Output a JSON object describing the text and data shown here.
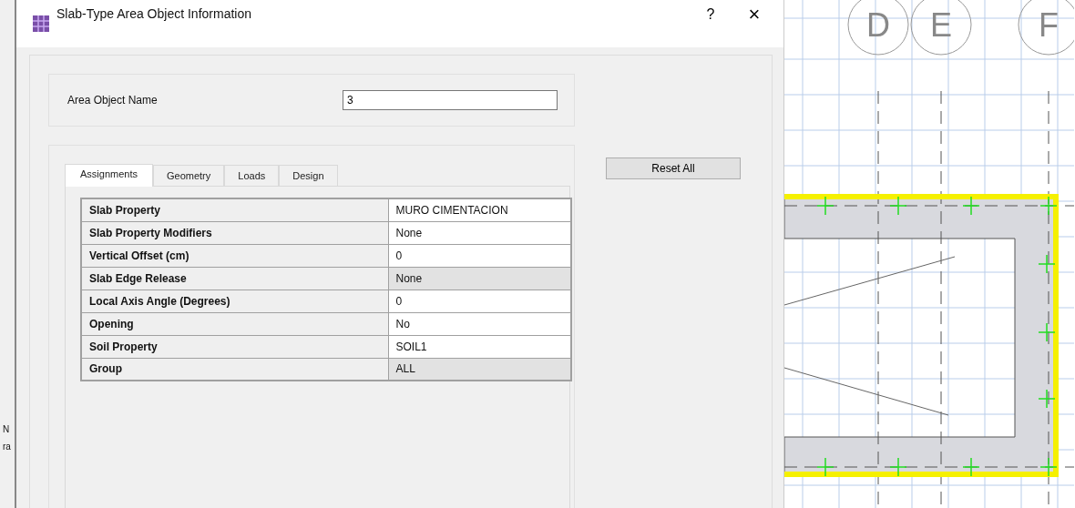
{
  "background_fragments": [
    "N",
    "ra"
  ],
  "window": {
    "title": "Slab-Type Area Object Information",
    "help": "?",
    "close": "×"
  },
  "area_object_name": {
    "label": "Area Object Name",
    "value": "3"
  },
  "tabs": [
    {
      "label": "Assignments",
      "selected": true
    },
    {
      "label": "Geometry",
      "selected": false
    },
    {
      "label": "Loads",
      "selected": false
    },
    {
      "label": "Design",
      "selected": false
    }
  ],
  "properties": [
    {
      "name": "Slab Property",
      "value": "MURO CIMENTACION",
      "editable": true
    },
    {
      "name": "Slab Property Modifiers",
      "value": "None",
      "editable": true
    },
    {
      "name": "Vertical Offset  (cm)",
      "value": "0",
      "editable": true
    },
    {
      "name": "Slab Edge Release",
      "value": "None",
      "editable": false
    },
    {
      "name": "Local Axis Angle  (Degrees)",
      "value": "0",
      "editable": true
    },
    {
      "name": "Opening",
      "value": "No",
      "editable": true
    },
    {
      "name": "Soil Property",
      "value": "SOIL1",
      "editable": true
    },
    {
      "name": "Group",
      "value": "ALL",
      "editable": false
    }
  ],
  "buttons": {
    "reset": "Reset All"
  },
  "drawing": {
    "grid_labels": [
      "D",
      "E",
      "F"
    ]
  }
}
